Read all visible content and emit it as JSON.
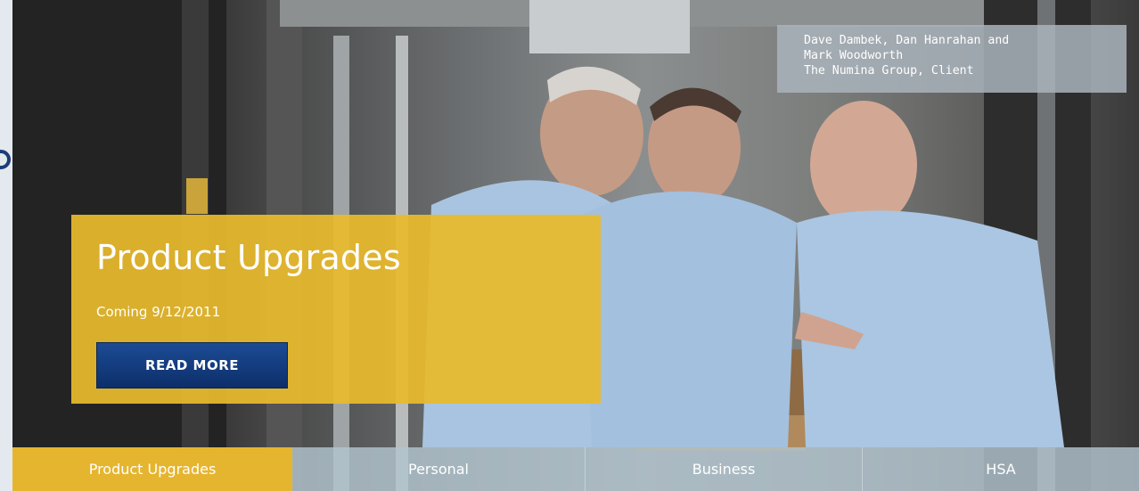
{
  "caption": {
    "line1": "Dave Dambek, Dan Hanrahan and",
    "line2": "Mark Woodworth",
    "line3": "The Numina Group, Client"
  },
  "promo": {
    "title": "Product Upgrades",
    "subtitle": "Coming 9/12/2011",
    "button_label": "READ MORE"
  },
  "tabs": [
    {
      "label": "Product Upgrades",
      "active": true
    },
    {
      "label": "Personal",
      "active": false
    },
    {
      "label": "Business",
      "active": false
    },
    {
      "label": "HSA",
      "active": false
    }
  ],
  "colors": {
    "accent_gold": "#e6b52f",
    "button_blue": "#133e80",
    "tab_bar": "#b2c4ce"
  },
  "icons": {
    "prev": "circle-arrow-icon"
  }
}
